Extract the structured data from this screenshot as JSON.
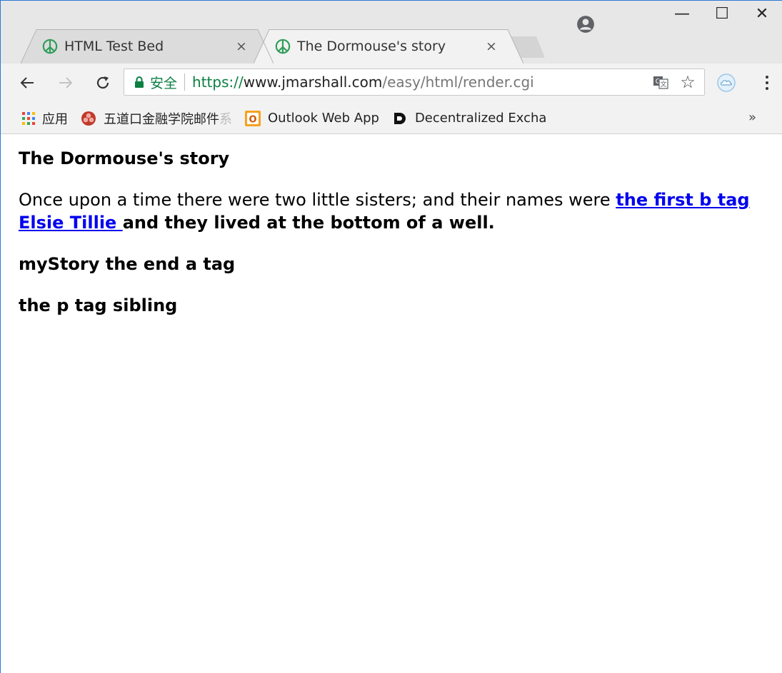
{
  "browser": {
    "tabs": [
      {
        "title": "HTML Test Bed",
        "active": false
      },
      {
        "title": "The Dormouse's story",
        "active": true
      }
    ],
    "tab_close_glyph": "×",
    "window_controls": {
      "minimize": "—",
      "maximize": "☐",
      "close": "✕"
    },
    "toolbar": {
      "back_glyph": "←",
      "forward_glyph": "→",
      "reload_glyph": "C",
      "secure_label": "安全",
      "url_scheme": "https://",
      "url_host": "www.jmarshall.com",
      "url_path": "/easy/html/render.cgi",
      "star_glyph": "☆",
      "menu_glyph": "⋮"
    },
    "bookmarks": {
      "apps_label": "应用",
      "items": [
        {
          "label": "五道口金融学院邮件",
          "fade": "系",
          "icon": "red-flower-icon"
        },
        {
          "label": "Outlook Web App",
          "icon": "outlook-icon"
        },
        {
          "label": "Decentralized Excha",
          "icon": "d-logo-icon"
        }
      ],
      "more_glyph": "»"
    },
    "colors": {
      "secure_green": "#0b8043",
      "link_blue": "#0000ee",
      "accent_border": "#2b79d6"
    }
  },
  "page": {
    "title": "The Dormouse's story",
    "para1_text": "Once upon a time there were two little sisters; and their names were ",
    "para1_link": "the first b tag Elsie Tillie ",
    "para1_bold_tail": "and they lived at the bottom of a well.",
    "para2": "myStory the end a tag",
    "para3": "the p tag sibling"
  }
}
